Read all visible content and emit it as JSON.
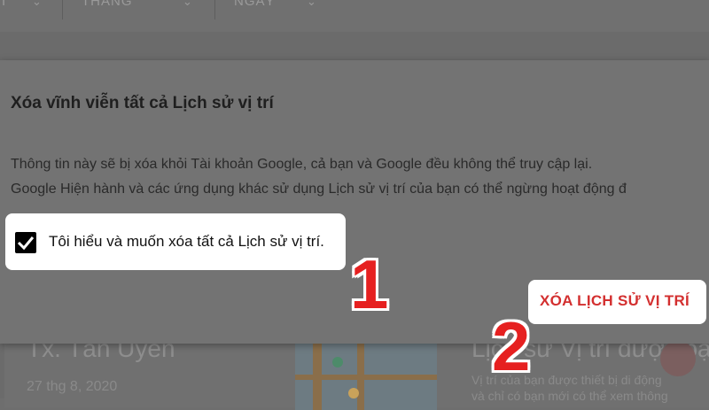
{
  "filters": [
    {
      "label": "I",
      "chevron": "chevron-down-icon"
    },
    {
      "label": "THÁNG",
      "chevron": "chevron-down-icon"
    },
    {
      "label": "NGÀY",
      "chevron": "chevron-down-icon"
    }
  ],
  "dialog": {
    "title": "Xóa vĩnh viễn tất cả Lịch sử vị trí",
    "body_line1": "Thông tin này sẽ bị xóa khỏi Tài khoản Google, cả bạn và Google đều không thể truy cập lại.",
    "body_line2": "Google Hiện hành và các ứng dụng khác sử dụng Lịch sử vị trí của bạn có thể ngừng hoạt động đ",
    "checkbox_label": "Tôi hiểu và muốn xóa tất cả Lịch sử vị trí.",
    "checkbox_checked": true,
    "delete_button": "XÓA LỊCH SỬ VỊ TRÍ",
    "delete_color": "#d32f2f"
  },
  "background": {
    "place_title": "Tx. Tân Uyên",
    "place_date": "27 thg 8, 2020",
    "info_title": "Lịch sử Vị trí được bạ",
    "info_line1": "Vị trí của bạn được thiết bị di động",
    "info_line2": "và chỉ có bạn mới có thể xem thông"
  },
  "annotations": {
    "step1": "1",
    "step2": "2",
    "color": "#e62020"
  }
}
